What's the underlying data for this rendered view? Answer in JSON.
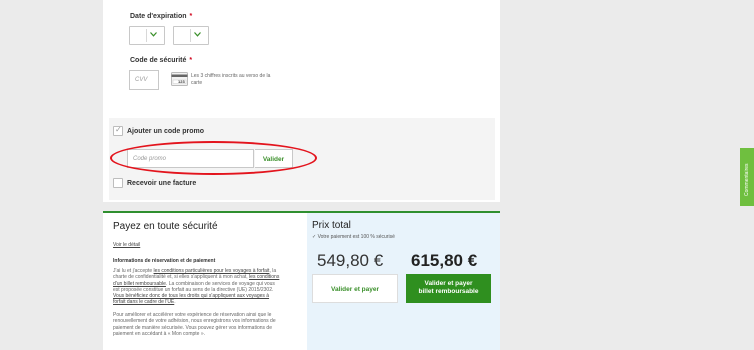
{
  "card_form": {
    "expiry_label": "Date d'expiration",
    "required_mark": "*",
    "expiry_month_value": "",
    "expiry_year_value": "",
    "security_label": "Code de sécurité",
    "cvv_placeholder": "CVV",
    "cvv_card_digits": "123",
    "cvv_help": "Les 3 chiffres inscrits au verso de la carte"
  },
  "promo": {
    "checkbox_label": "Ajouter un code promo",
    "checked": true,
    "input_placeholder": "Code promo",
    "validate_label": "Valider",
    "invoice_label": "Recevoir une facture"
  },
  "secure_pay": {
    "title": "Payez en toute sécurité",
    "detail_link": "Voir le détail",
    "info_heading": "Informations de réservation et de paiement",
    "para1_a": "J'ai lu et j'accepte ",
    "para1_l1": "les conditions particulières pour les voyages à forfait",
    "para1_b": ", la charte de confidentialité et, si elles s'appliquent à mon achat, ",
    "para1_l2": "les conditions d'un billet remboursable",
    "para1_c": ". La combinaison de services de voyage qui vous est proposée constitue un forfait au sens de la directive (UE) 2015/2302. ",
    "para1_l3": "Vous bénéficiez donc de tous les droits qui s'appliquent aux voyages à forfait dans le cadre de l'UE",
    "para1_d": ".",
    "para2": "Pour améliorer et accélérer votre expérience de réservation ainsi que le renouvellement de votre adhésion, nous enregistrons vos informations de paiement de manière sécurisée. Vous pouvez gérer vos informations de paiement en accédant à « Mon compte »."
  },
  "total": {
    "title": "Prix total",
    "secure_note": "✓ Votre paiement est 100 % sécurisé",
    "price_standard": "549,80 €",
    "price_refundable": "615,80 €",
    "btn_pay": "Valider et payer",
    "btn_pay_refundable_1": "Valider et payer",
    "btn_pay_refundable_2": "billet remboursable"
  },
  "feedback": {
    "label": "Commentaires"
  },
  "colors": {
    "accent_green": "#2f8f1f",
    "highlight_red": "#e3141d",
    "total_panel_bg": "#e8f3fb"
  }
}
